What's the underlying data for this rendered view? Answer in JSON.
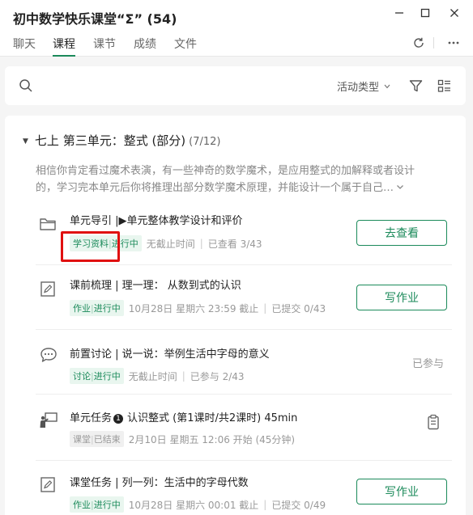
{
  "window": {
    "title": "初中数学快乐课堂“Σ” (54)"
  },
  "tabs": [
    {
      "label": "聊天",
      "active": false
    },
    {
      "label": "课程",
      "active": true
    },
    {
      "label": "课节",
      "active": false
    },
    {
      "label": "成绩",
      "active": false
    },
    {
      "label": "文件",
      "active": false
    }
  ],
  "filter": {
    "activity_type": "活动类型"
  },
  "unit": {
    "title": "七上 第三单元：整式 (部分)",
    "progress": "(7/12)",
    "description_line1": "相信你肯定看过魔术表演，有一些神奇的数学魔术，是应用整式的加解释或者设计",
    "description_line2": "的，学习完本单元后你将推理出部分数学魔术原理，并能设计一个属于自己…"
  },
  "items": [
    {
      "icon": "folder-icon",
      "name": "单元导引 |▶单元整体教学设计和评价",
      "type": "学习资料",
      "status": "进行中",
      "deadline": "无截止时间",
      "stat": "已查看 3/43",
      "action": "去查看"
    },
    {
      "icon": "homework-icon",
      "name": "课前梳理 | 理一理：  从数到式的认识",
      "type": "作业",
      "status": "进行中",
      "deadline": "10月28日 星期六 23:59 截止",
      "stat": "已提交 0/43",
      "action": "写作业"
    },
    {
      "icon": "discussion-icon",
      "name": "前置讨论 | 说一说：举例生活中字母的意义",
      "type": "讨论",
      "status": "进行中",
      "deadline": "无截止时间",
      "stat": "已参与 2/43",
      "action": "已参与"
    },
    {
      "icon": "lesson-icon",
      "name_prefix": "单元任务",
      "name_num": "1",
      "name": "认识整式   (第1课时/共2课时)  45min",
      "type": "课堂",
      "status": "已结束",
      "deadline": "2月10日 星期五 12:06 开始 (45分钟)",
      "stat": ""
    },
    {
      "icon": "homework-icon",
      "name": "课堂任务 | 列一列：生活中的字母代数",
      "type": "作业",
      "status": "进行中",
      "deadline": "10月28日 星期六 00:01 截止",
      "stat": "已提交 0/49",
      "action": "写作业"
    }
  ],
  "separator": "|",
  "colors": {
    "accent": "#1b8a5a",
    "highlight": "#e01010"
  }
}
